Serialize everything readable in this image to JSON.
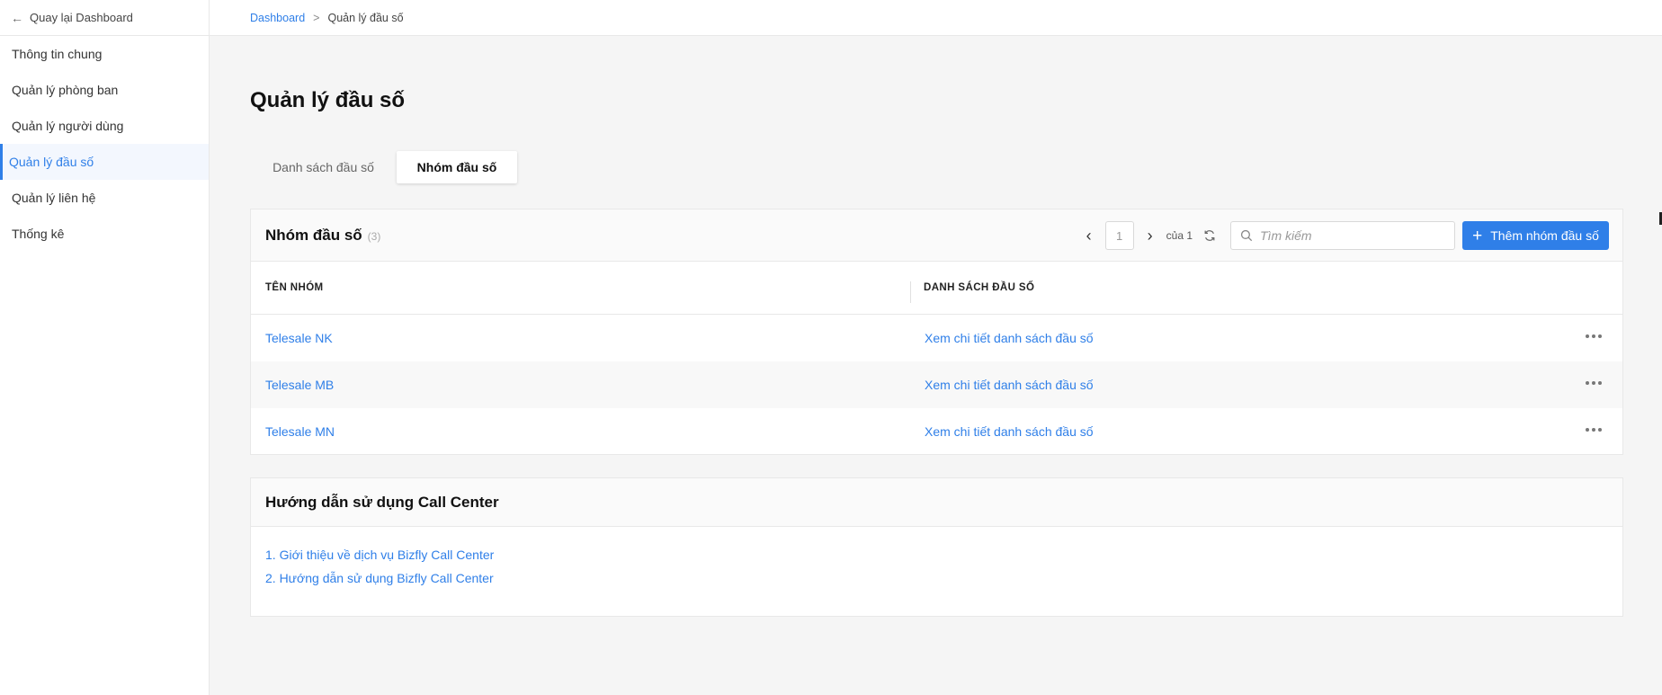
{
  "sidebar": {
    "back_label": "Quay lại Dashboard",
    "items": [
      {
        "label": "Thông tin chung"
      },
      {
        "label": "Quản lý phòng ban"
      },
      {
        "label": "Quản lý người dùng"
      },
      {
        "label": "Quản lý đầu số",
        "active": true
      },
      {
        "label": "Quản lý liên hệ"
      },
      {
        "label": "Thống kê"
      }
    ]
  },
  "breadcrumb": {
    "root": "Dashboard",
    "separator": ">",
    "current": "Quản lý đầu số"
  },
  "page": {
    "title": "Quản lý đầu số",
    "tabs": [
      {
        "label": "Danh sách đầu số",
        "active": false
      },
      {
        "label": "Nhóm đầu số",
        "active": true
      }
    ]
  },
  "group_card": {
    "title": "Nhóm đầu số",
    "count": "(3)",
    "pagination": {
      "prev": "‹",
      "next": "›",
      "current_page": "1",
      "of_label": "của 1"
    },
    "search": {
      "placeholder": "Tìm kiếm",
      "value": ""
    },
    "add_button": {
      "plus": "+",
      "label": "Thêm nhóm đầu số"
    },
    "columns": [
      "TÊN NHÓM",
      "DANH SÁCH ĐẦU SỐ"
    ],
    "rows": [
      {
        "name": "Telesale NK",
        "link": "Xem chi tiết danh sách đầu số"
      },
      {
        "name": "Telesale MB",
        "link": "Xem chi tiết danh sách đầu số"
      },
      {
        "name": "Telesale MN",
        "link": "Xem chi tiết danh sách đầu số"
      }
    ]
  },
  "guide_card": {
    "title": "Hướng dẫn sử dụng Call Center",
    "items": [
      "1. Giới thiệu về dịch vụ Bizfly Call Center",
      "2. Hướng dẫn sử dụng Bizfly Call Center"
    ]
  },
  "colors": {
    "accent": "#2f7fe8",
    "background": "#f5f5f5",
    "card_header": "#fafafa"
  },
  "icons": {
    "back": "arrow-left-icon",
    "prev": "chevron-left-icon",
    "next": "chevron-right-icon",
    "refresh": "refresh-icon",
    "search": "search-icon",
    "add": "plus-icon",
    "more": "more-horizontal-icon"
  }
}
